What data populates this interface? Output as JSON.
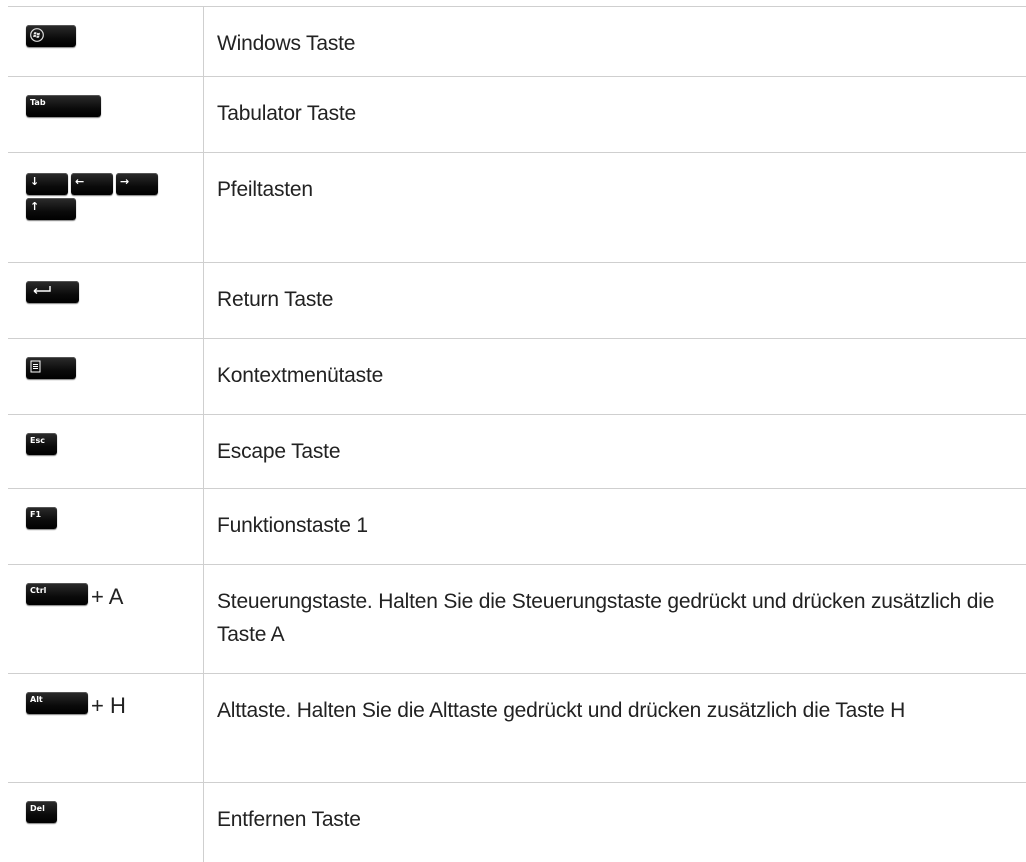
{
  "rows": [
    {
      "key": "",
      "desc": "Windows Taste"
    },
    {
      "key": "Tab",
      "desc": "Tabulator Taste"
    },
    {
      "key": "↓ ← → ↑",
      "desc": "Pfeiltasten"
    },
    {
      "key": "",
      "desc": "Return Taste"
    },
    {
      "key": "",
      "desc": "Kontextmenütaste"
    },
    {
      "key": "Esc",
      "desc": "Escape Taste"
    },
    {
      "key": "F1",
      "desc": "Funktionstaste 1"
    },
    {
      "key": "Ctrl",
      "combo": "+ A",
      "desc": "Steuerungstaste. Halten Sie die Steuerungstaste gedrückt und drücken zusätzlich die Taste A"
    },
    {
      "key": "Alt",
      "combo": "+ H",
      "desc": "Alttaste. Halten Sie die Alttaste gedrückt und drücken zusätzlich die Taste H"
    },
    {
      "key": "Del",
      "desc": "Entfernen Taste"
    }
  ],
  "arrows": [
    "↓",
    "←",
    "→",
    "↑"
  ],
  "icons": {
    "windows": "windows-logo-icon",
    "return": "return-arrow-icon",
    "context": "context-menu-icon"
  }
}
